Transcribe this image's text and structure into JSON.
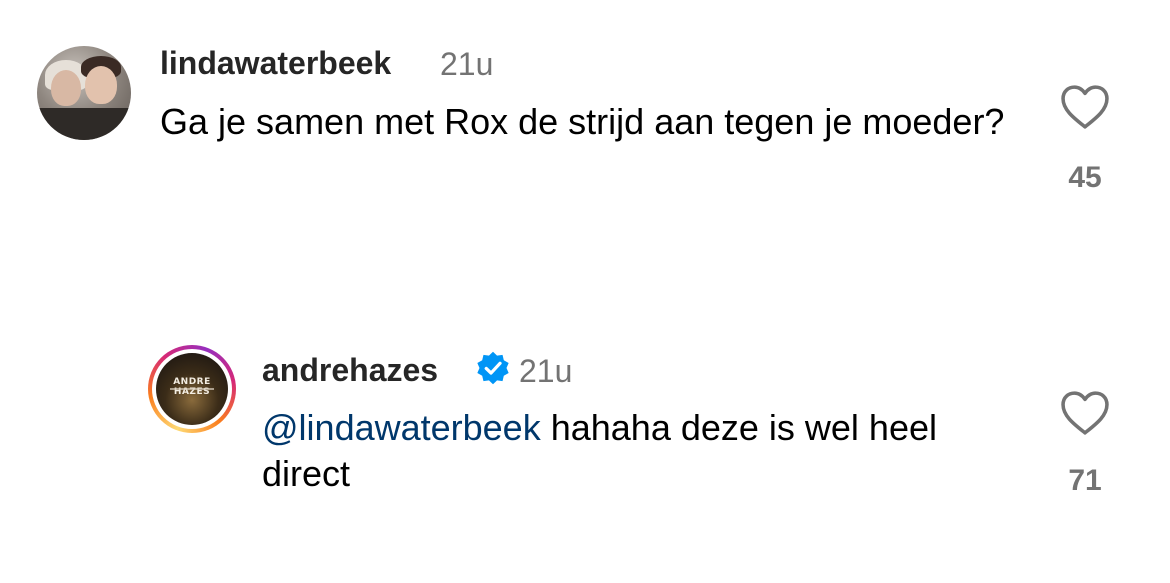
{
  "comments": [
    {
      "username": "lindawaterbeek",
      "time": "21u",
      "text": "Ga je samen met Rox de strijd aan tegen je moeder?",
      "likes": "45",
      "avatar_icon": "profile-photo-two-women",
      "verified": false
    },
    {
      "username": "andrehazes",
      "time": "21u",
      "mention": "@lindawaterbeek",
      "text": " hahaha deze is wel heel direct",
      "likes": "71",
      "avatar_text": "ANDRE HAZES",
      "verified": true,
      "verified_color": "#0095f6",
      "story_ring": true
    }
  ],
  "colors": {
    "username": "#262626",
    "secondary": "#737373",
    "mention": "#00376b",
    "heart_stroke": "#737373"
  },
  "icons": {
    "like": "heart-outline-icon",
    "verified": "verified-badge-icon"
  }
}
